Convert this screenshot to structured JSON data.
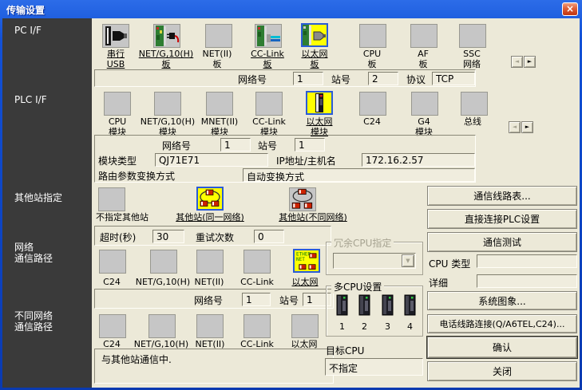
{
  "window": {
    "title": "传输设置"
  },
  "glyphs": {
    "close": "×",
    "left": "◄",
    "right": "►",
    "down": "▼"
  },
  "colors": {
    "titlebar_blue": "#0d45c4",
    "dialog_bg": "#ece9d8",
    "sidebar_bg": "#3a3a3a",
    "selected_icon_bg": "#ffff00",
    "selection_border": "#2a5bd7",
    "close_red": "#c43a16"
  },
  "icons": {
    "serial-usb-icon": "serial connector with plug",
    "board-plug-icon": "interface board with power plug",
    "gray-board-icon": "plain gray square",
    "board-cable-icon": "interface board with cable",
    "ethernet-board-icon": "ethernet board (selected yellow)",
    "ethernet-module-icon": "ethernet module (selected yellow)",
    "no-other-station-icon": "plain gray square",
    "other-station-same-icon": "stations on same network (yellow)",
    "other-station-diff-icon": "stations on different network (gray)",
    "ethernet-route-icon": "ETHER NET route (yellow)",
    "cpu-tower-icon": "PLC CPU unit"
  },
  "sidebar": {
    "pc_if": "PC I/F",
    "plc_if": "PLC I/F",
    "other_station": "其他站指定",
    "net_line1": "网络",
    "net_line2": "通信路径",
    "diff_line1": "不同网络",
    "diff_line2": "通信路径"
  },
  "pc_if": {
    "items": [
      {
        "l1": "串行",
        "l2": "USB"
      },
      {
        "l1": "NET/G,10(H)",
        "l2": "板"
      },
      {
        "l1": "NET(II)",
        "l2": "板"
      },
      {
        "l1": "CC-Link",
        "l2": "板"
      },
      {
        "l1": "以太网",
        "l2": "板"
      },
      {
        "l1": "CPU",
        "l2": "板"
      },
      {
        "l1": "AF",
        "l2": "板"
      },
      {
        "l1": "SSC",
        "l2": "网络"
      }
    ],
    "network_label": "网络号",
    "network_value": "1",
    "station_label": "站号",
    "station_value": "2",
    "protocol_label": "协议",
    "protocol_value": "TCP"
  },
  "plc_if": {
    "items": [
      {
        "l1": "CPU",
        "l2": "模块"
      },
      {
        "l1": "NET/G,10(H)",
        "l2": "模块"
      },
      {
        "l1": "MNET(II)",
        "l2": "模块"
      },
      {
        "l1": "CC-Link",
        "l2": "模块"
      },
      {
        "l1": "以太网",
        "l2": "模块"
      },
      {
        "l1": "C24",
        "l2": ""
      },
      {
        "l1": "G4",
        "l2": "模块"
      },
      {
        "l1": "总线",
        "l2": ""
      }
    ],
    "network_label": "网络号",
    "network_value": "1",
    "station_label": "站号",
    "station_value": "1",
    "module_type_label": "模块类型",
    "module_type_value": "QJ71E71",
    "ip_label": "IP地址/主机名",
    "ip_value": "172.16.2.57",
    "route_label": "路由参数变换方式",
    "route_value": "自动变换方式"
  },
  "other_station": {
    "items": [
      {
        "label": "不指定其他站"
      },
      {
        "label": "其他站(同一网络)"
      },
      {
        "label": "其他站(不同网络)"
      }
    ],
    "timeout_label": "超时(秒)",
    "timeout_value": "30",
    "retry_label": "重试次数",
    "retry_value": "0"
  },
  "network_route": {
    "items": [
      {
        "label": "C24"
      },
      {
        "label": "NET/G,10(H)"
      },
      {
        "label": "NET(II)"
      },
      {
        "label": "CC-Link"
      },
      {
        "label": "以太网"
      }
    ],
    "network_label": "网络号",
    "network_value": "1",
    "station_label": "站号",
    "station_value": "1"
  },
  "diff_route": {
    "items": [
      {
        "label": "C24"
      },
      {
        "label": "NET/G,10(H)"
      },
      {
        "label": "NET(II)"
      },
      {
        "label": "CC-Link"
      },
      {
        "label": "以太网"
      }
    ],
    "message": "与其他站通信中."
  },
  "middle": {
    "redundant_label": "冗余CPU指定",
    "multi_cpu_label": "多CPU设置",
    "cpu_numbers": [
      "1",
      "2",
      "3",
      "4"
    ],
    "target_label": "目标CPU",
    "target_value": "不指定"
  },
  "right": {
    "comm_line_btn": "通信线路表...",
    "direct_plc_btn": "直接连接PLC设置",
    "comm_test_btn": "通信测试",
    "cpu_type_label": "CPU 类型",
    "detail_label": "详细",
    "system_image_btn": "系统图象...",
    "phone_btn": "电话线路连接(Q/A6TEL,C24)...",
    "confirm_btn": "确认",
    "close_btn": "关闭"
  }
}
